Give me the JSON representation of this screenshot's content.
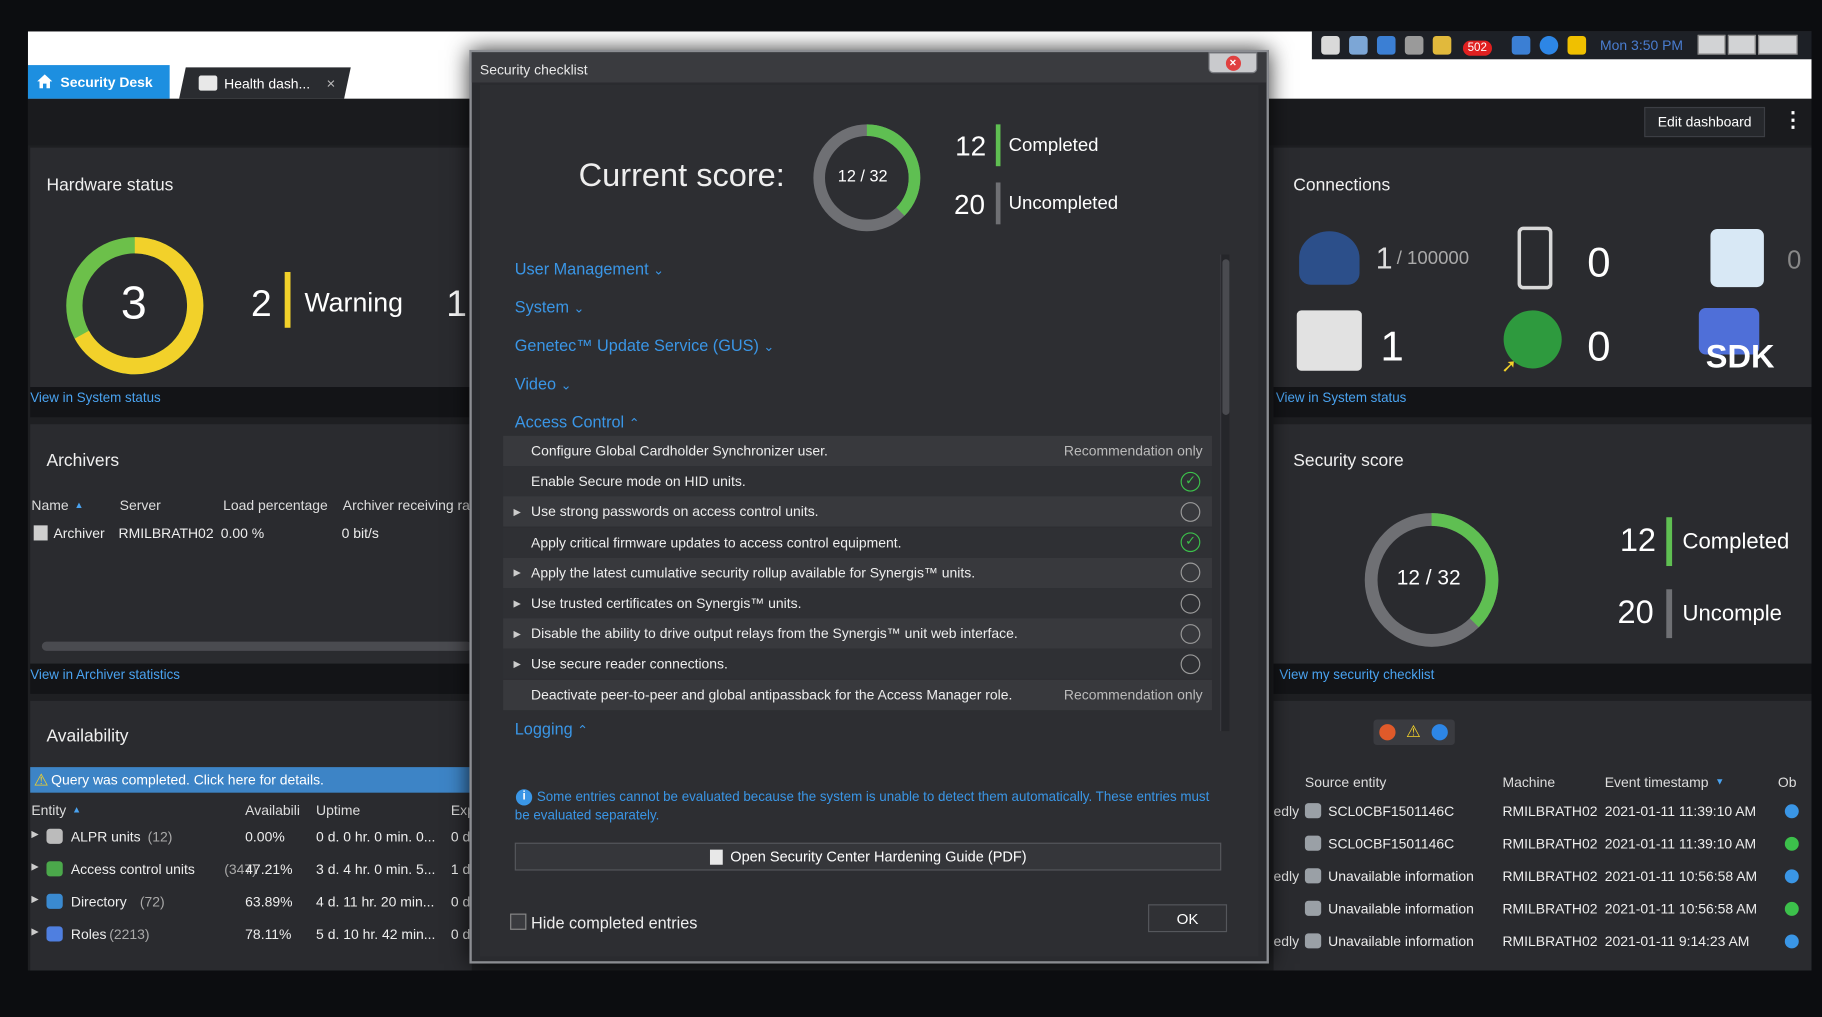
{
  "tabs": [
    {
      "label": "Security Desk"
    },
    {
      "label": "Health dash...",
      "close": "×"
    }
  ],
  "taskbar": {
    "badge": "502",
    "time": "Mon 3:50 PM"
  },
  "toolbar": {
    "edit_dashboard": "Edit dashboard",
    "menu": "⋮"
  },
  "hardware_status": {
    "title": "Hardware status",
    "total": "3",
    "warning_count": "2",
    "warning_label": "Warning",
    "other_count": "1",
    "link": "View in System status",
    "warning_fraction": 0.67
  },
  "archivers": {
    "title": "Archivers",
    "columns": [
      "Name",
      "Server",
      "Load percentage",
      "Archiver receiving ra"
    ],
    "rows": [
      [
        "Archiver",
        "RMILBRATH02",
        "0.00 %",
        "0 bit/s"
      ]
    ],
    "link": "View in Archiver statistics"
  },
  "availability": {
    "title": "Availability",
    "banner": "Query was completed. Click here for details.",
    "columns": [
      "Entity",
      "Availabili",
      "Uptime",
      "Exp"
    ],
    "rows": [
      {
        "entity": "ALPR units",
        "count": "(12)",
        "availability": "0.00%",
        "uptime": "0 d. 0 hr. 0 min. 0...",
        "exp": "0 d"
      },
      {
        "entity": "Access control units",
        "count": "(347)",
        "availability": "47.21%",
        "uptime": "3 d. 4 hr. 0 min. 5...",
        "exp": "1 d"
      },
      {
        "entity": "Directory",
        "count": "(72)",
        "availability": "63.89%",
        "uptime": "4 d. 11 hr. 20 min...",
        "exp": "0 d"
      },
      {
        "entity": "Roles",
        "count": "(2213)",
        "availability": "78.11%",
        "uptime": "5 d. 10 hr. 42 min...",
        "exp": "0 d"
      }
    ]
  },
  "connections": {
    "title": "Connections",
    "officer_count": "1",
    "officer_total": "/ 100000",
    "mobile_count": "0",
    "web_prefix": "0",
    "server_count": "1",
    "globe_count": "0",
    "sdk_label": "SDK",
    "link": "View in System status"
  },
  "security_score_panel": {
    "title": "Security score",
    "score": "12 / 32",
    "completed_count": "12",
    "completed_label": "Completed",
    "uncompleted_count": "20",
    "uncompleted_label": "Uncomple",
    "link": "View my security checklist",
    "fraction": 0.375
  },
  "events": {
    "columns": [
      "Source entity",
      "Machine",
      "Event timestamp",
      "Ob"
    ],
    "rows": [
      {
        "prefix": "edly",
        "source": "SCL0CBF1501146C",
        "machine": "RMILBRATH02",
        "timestamp": "2021-01-11 11:39:10 AM"
      },
      {
        "prefix": "",
        "source": "SCL0CBF1501146C",
        "machine": "RMILBRATH02",
        "timestamp": "2021-01-11 11:39:10 AM"
      },
      {
        "prefix": "edly",
        "source": "Unavailable information",
        "machine": "RMILBRATH02",
        "timestamp": "2021-01-11 10:56:58 AM"
      },
      {
        "prefix": "",
        "source": "Unavailable information",
        "machine": "RMILBRATH02",
        "timestamp": "2021-01-11 10:56:58 AM"
      },
      {
        "prefix": "edly",
        "source": "Unavailable information",
        "machine": "RMILBRATH02",
        "timestamp": "2021-01-11 9:14:23 AM"
      }
    ]
  },
  "dialog": {
    "title": "Security checklist",
    "current_score_label": "Current score:",
    "score": "12 / 32",
    "completed_count": "12",
    "completed_label": "Completed",
    "uncompleted_count": "20",
    "uncompleted_label": "Uncompleted",
    "score_fraction": 0.375,
    "categories": [
      {
        "label": "User Management",
        "chev": "⌄"
      },
      {
        "label": "System",
        "chev": "⌄"
      },
      {
        "label": "Genetec™ Update Service (GUS)",
        "chev": "⌄"
      },
      {
        "label": "Video",
        "chev": "⌄"
      },
      {
        "label": "Access Control",
        "chev": "⌃"
      }
    ],
    "items": [
      {
        "label": "Configure Global Cardholder Synchronizer user.",
        "status": "Recommendation only",
        "expand": false,
        "state": "rec"
      },
      {
        "label": "Enable Secure mode on HID units.",
        "status": "",
        "expand": false,
        "state": "done"
      },
      {
        "label": "Use strong passwords on access control units.",
        "status": "",
        "expand": true,
        "state": "open"
      },
      {
        "label": "Apply critical firmware updates to access control equipment.",
        "status": "",
        "expand": false,
        "state": "done"
      },
      {
        "label": "Apply the latest cumulative security rollup available for Synergis™ units.",
        "status": "",
        "expand": true,
        "state": "open"
      },
      {
        "label": "Use trusted certificates on Synergis™ units.",
        "status": "",
        "expand": true,
        "state": "open"
      },
      {
        "label": "Disable the ability to drive output relays from the Synergis™ unit web interface.",
        "status": "",
        "expand": true,
        "state": "open"
      },
      {
        "label": "Use secure reader connections.",
        "status": "",
        "expand": true,
        "state": "open"
      },
      {
        "label": "Deactivate peer-to-peer and global antipassback for the Access Manager role.",
        "status": "Recommendation only",
        "expand": false,
        "state": "rec"
      }
    ],
    "logging": {
      "label": "Logging",
      "chev": "⌃"
    },
    "info_text": "Some entries cannot be evaluated because the system is unable to detect them automatically. These entries must be evaluated separately.",
    "hardening_button": "Open Security Center Hardening Guide (PDF)",
    "hide_completed": "Hide completed entries",
    "ok": "OK"
  },
  "colors": {
    "accent": "#1d8fe0",
    "link": "#3a96e6",
    "green": "#3cc04b",
    "warning": "#f2d12a",
    "ring_gray": "#6f7074"
  }
}
